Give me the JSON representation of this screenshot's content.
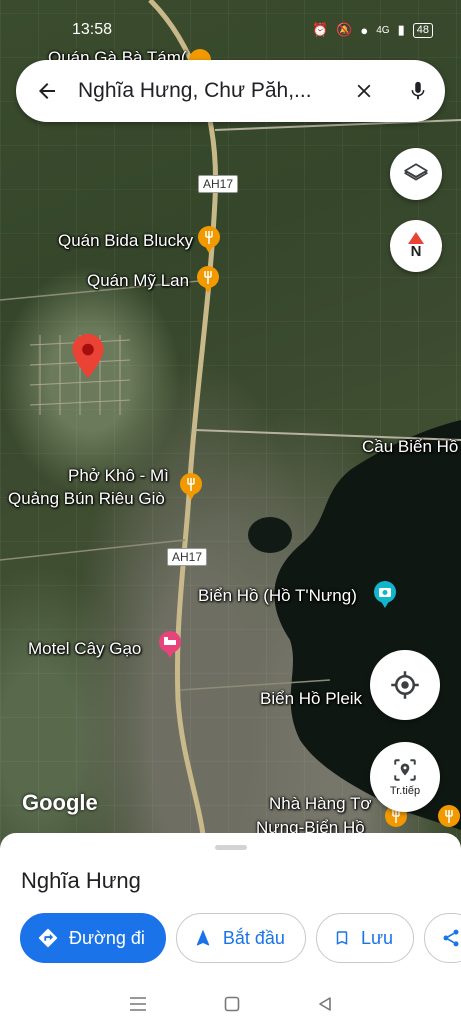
{
  "status": {
    "time": "13:58",
    "network": "4G",
    "battery": "48"
  },
  "search": {
    "query": "Nghĩa Hưng, Chư Păh,..."
  },
  "map": {
    "labels": {
      "quan_ga": "Quán Gà Bà Tám(",
      "bida": "Quán Bida Blucky",
      "my_lan": "Quán Mỹ Lan",
      "cau_bien_ho": "Cầu Biển Hồ",
      "pho_kho_1": "Phở Khô - Mì",
      "pho_kho_2": "Quảng Bún Riêu Giò",
      "bien_ho_tnung": "Biển Hồ (Hồ T'Nưng)",
      "motel": "Motel Cây Gạo",
      "bien_ho_pleiku": "Biển Hồ Pleik",
      "nha_hang_1": "Nhà Hàng Tơ",
      "nha_hang_2": "Nưng-Biển Hồ"
    },
    "road_shields": [
      "AH17",
      "AH17"
    ],
    "compass_letter": "N",
    "street_view_label": "Tr.tiếp",
    "attribution": "Google"
  },
  "sheet": {
    "place_name": "Nghĩa Hưng",
    "directions_label": "Đường đi",
    "start_label": "Bắt đầu",
    "save_label": "Lưu"
  },
  "colors": {
    "accent": "#1a73e8",
    "pin_red": "#ea4335",
    "poi_orange": "#f29900",
    "hotel_pink": "#e8437a",
    "tourist_blue": "#12b5cb"
  }
}
